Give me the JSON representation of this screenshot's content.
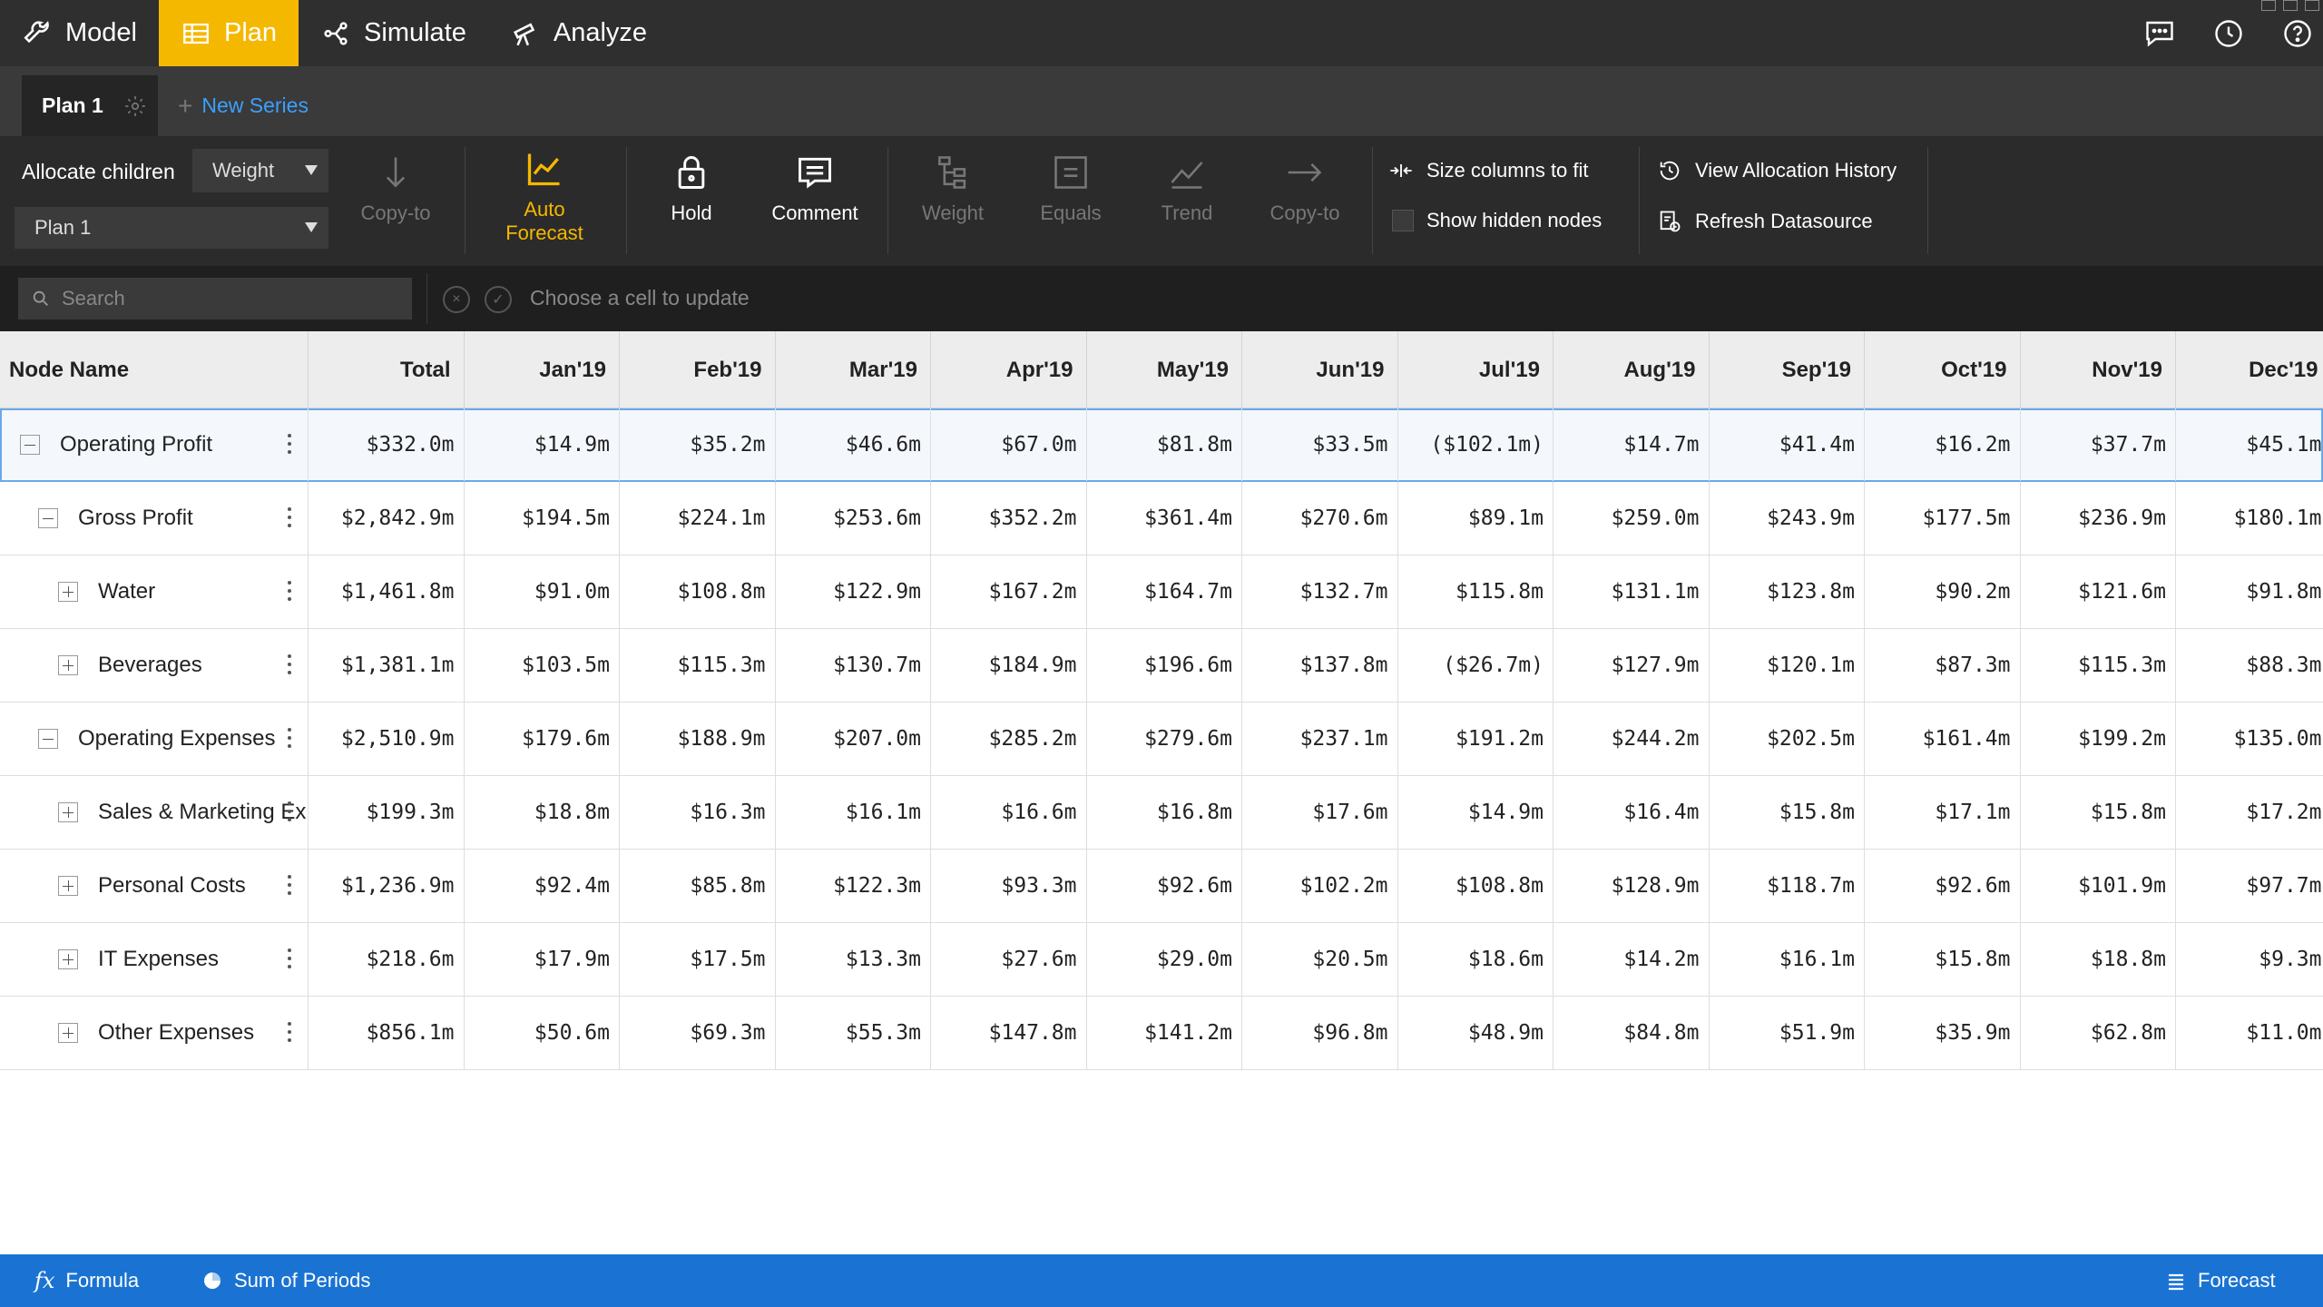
{
  "nav": {
    "tabs": [
      {
        "label": "Model",
        "icon": "wrench-icon"
      },
      {
        "label": "Plan",
        "icon": "grid-table-icon"
      },
      {
        "label": "Simulate",
        "icon": "branch-icon"
      },
      {
        "label": "Analyze",
        "icon": "telescope-icon"
      }
    ],
    "active_tab": "Plan",
    "right_icons": [
      "chat-icon",
      "history-clock-icon",
      "help-icon"
    ]
  },
  "series": {
    "active_label": "Plan 1",
    "new_label": "New Series"
  },
  "ribbon": {
    "allocate_label": "Allocate children",
    "allocate_value": "Weight",
    "plan_value": "Plan 1",
    "buttons": {
      "copy_to_1": "Copy-to",
      "auto_forecast_line1": "Auto",
      "auto_forecast_line2": "Forecast",
      "hold": "Hold",
      "comment": "Comment",
      "weight": "Weight",
      "equals": "Equals",
      "trend": "Trend",
      "copy_to_2": "Copy-to"
    },
    "size_columns": "Size columns to fit",
    "show_hidden": "Show hidden nodes",
    "view_history": "View Allocation History",
    "refresh": "Refresh Datasource"
  },
  "formula_bar": {
    "search_placeholder": "Search",
    "hint": "Choose a cell to update"
  },
  "grid": {
    "name_header": "Node Name",
    "columns": [
      "Total",
      "Jan'19",
      "Feb'19",
      "Mar'19",
      "Apr'19",
      "May'19",
      "Jun'19",
      "Jul'19",
      "Aug'19",
      "Sep'19",
      "Oct'19",
      "Nov'19",
      "Dec'19"
    ],
    "rows": [
      {
        "name": "Operating Profit",
        "level": 0,
        "toggle": "minus",
        "selected": true,
        "values": [
          "$332.0m",
          "$14.9m",
          "$35.2m",
          "$46.6m",
          "$67.0m",
          "$81.8m",
          "$33.5m",
          "($102.1m)",
          "$14.7m",
          "$41.4m",
          "$16.2m",
          "$37.7m",
          "$45.1m"
        ]
      },
      {
        "name": "Gross Profit",
        "level": 1,
        "toggle": "minus",
        "selected": false,
        "values": [
          "$2,842.9m",
          "$194.5m",
          "$224.1m",
          "$253.6m",
          "$352.2m",
          "$361.4m",
          "$270.6m",
          "$89.1m",
          "$259.0m",
          "$243.9m",
          "$177.5m",
          "$236.9m",
          "$180.1m"
        ]
      },
      {
        "name": "Water",
        "level": 2,
        "toggle": "plus",
        "selected": false,
        "values": [
          "$1,461.8m",
          "$91.0m",
          "$108.8m",
          "$122.9m",
          "$167.2m",
          "$164.7m",
          "$132.7m",
          "$115.8m",
          "$131.1m",
          "$123.8m",
          "$90.2m",
          "$121.6m",
          "$91.8m"
        ]
      },
      {
        "name": "Beverages",
        "level": 2,
        "toggle": "plus",
        "selected": false,
        "values": [
          "$1,381.1m",
          "$103.5m",
          "$115.3m",
          "$130.7m",
          "$184.9m",
          "$196.6m",
          "$137.8m",
          "($26.7m)",
          "$127.9m",
          "$120.1m",
          "$87.3m",
          "$115.3m",
          "$88.3m"
        ]
      },
      {
        "name": "Operating Expenses",
        "level": 1,
        "toggle": "minus",
        "selected": false,
        "values": [
          "$2,510.9m",
          "$179.6m",
          "$188.9m",
          "$207.0m",
          "$285.2m",
          "$279.6m",
          "$237.1m",
          "$191.2m",
          "$244.2m",
          "$202.5m",
          "$161.4m",
          "$199.2m",
          "$135.0m"
        ]
      },
      {
        "name": "Sales & Marketing Ex",
        "level": 2,
        "toggle": "plus",
        "selected": false,
        "values": [
          "$199.3m",
          "$18.8m",
          "$16.3m",
          "$16.1m",
          "$16.6m",
          "$16.8m",
          "$17.6m",
          "$14.9m",
          "$16.4m",
          "$15.8m",
          "$17.1m",
          "$15.8m",
          "$17.2m"
        ]
      },
      {
        "name": "Personal Costs",
        "level": 2,
        "toggle": "plus",
        "selected": false,
        "values": [
          "$1,236.9m",
          "$92.4m",
          "$85.8m",
          "$122.3m",
          "$93.3m",
          "$92.6m",
          "$102.2m",
          "$108.8m",
          "$128.9m",
          "$118.7m",
          "$92.6m",
          "$101.9m",
          "$97.7m"
        ]
      },
      {
        "name": "IT Expenses",
        "level": 2,
        "toggle": "plus",
        "selected": false,
        "values": [
          "$218.6m",
          "$17.9m",
          "$17.5m",
          "$13.3m",
          "$27.6m",
          "$29.0m",
          "$20.5m",
          "$18.6m",
          "$14.2m",
          "$16.1m",
          "$15.8m",
          "$18.8m",
          "$9.3m"
        ]
      },
      {
        "name": "Other Expenses",
        "level": 2,
        "toggle": "plus",
        "selected": false,
        "values": [
          "$856.1m",
          "$50.6m",
          "$69.3m",
          "$55.3m",
          "$147.8m",
          "$141.2m",
          "$96.8m",
          "$48.9m",
          "$84.8m",
          "$51.9m",
          "$35.9m",
          "$62.8m",
          "$11.0m"
        ]
      }
    ]
  },
  "status": {
    "formula": "Formula",
    "sum_of_periods": "Sum of Periods",
    "forecast": "Forecast"
  },
  "colors": {
    "accent_yellow": "#f5b800",
    "status_blue": "#1a73d2",
    "link_blue": "#3aa0ff"
  }
}
